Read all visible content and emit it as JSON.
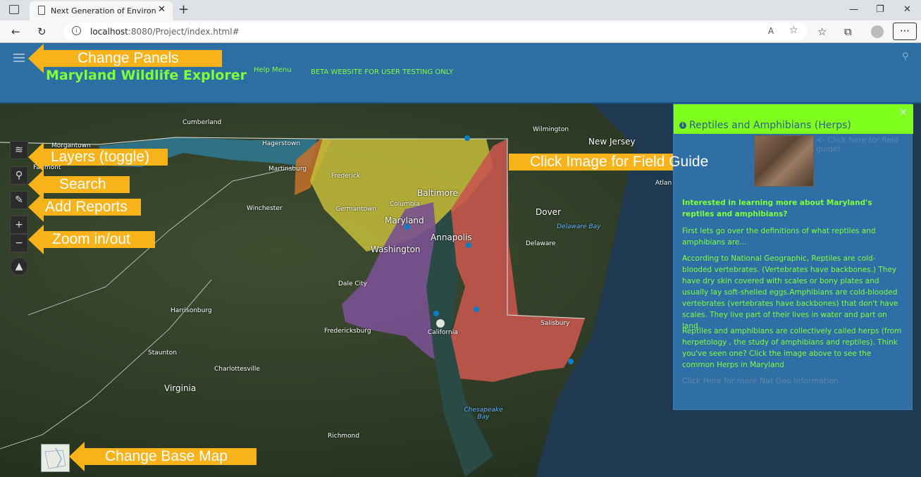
{
  "browser": {
    "tab_title": "Next Generation of Environment",
    "tab_close": "✕",
    "new_tab": "+",
    "url_host": "localhost",
    "url_path": ":8080/Project/index.html#",
    "win_min": "—",
    "win_max": "❐",
    "win_close": "✕",
    "more": "⋯"
  },
  "app": {
    "title": "Maryland Wildlife Explorer",
    "help_menu": "Help Menu",
    "beta": "BETA WEBSITE FOR USER TESTING ONLY"
  },
  "annotations": {
    "change_panels": "Change Panels",
    "layers": "Layers (toggle)",
    "search": "Search",
    "add_reports": "Add Reports",
    "zoom": "Zoom in/out",
    "field_guide": "Click Image for Field Guide",
    "base_map": "Change Base Map"
  },
  "map_labels": {
    "morgantown": "Morgantown",
    "fairmont": "Fairmont",
    "cumberland": "Cumberland",
    "hagerstown": "Hagerstown",
    "martinsburg": "Martinsburg",
    "frederick": "Frederick",
    "winchester": "Winchester",
    "germantown": "Germantown",
    "columbia": "Columbia",
    "baltimore": "Baltimore",
    "maryland": "Maryland",
    "annapolis": "Annapolis",
    "washington": "Washington",
    "dale_city": "Dale City",
    "harrisonburg": "Harrisonburg",
    "fredericksburg": "Fredericksburg",
    "california": "California",
    "staunton": "Staunton",
    "charlottesville": "Charlottesville",
    "virginia": "Virginia",
    "richmond": "Richmond",
    "chesapeake_bay": "Chesapeake Bay",
    "wilmington": "Wilmington",
    "new_jersey": "New Jersey",
    "dover": "Dover",
    "delaware_bay": "Delaware Bay",
    "delaware": "Delaware",
    "salisbury": "Salisbury",
    "atlantic": "Atlan"
  },
  "panel": {
    "title": "Reptiles and Amphibians (Herps)",
    "close": "✕",
    "field_hint": "<- Click here for field guide!",
    "intro": "Interested in learning more about Maryland's reptiles and amphibians?",
    "definitions": "First lets go over the definitions of what reptiles and amphibians are...",
    "description": "According to National Geographic, Reptiles are cold-blooded vertebrates. (Vertebrates have backbones.) They have dry skin covered with scales or bony plates and usually lay soft-shelled eggs.Amphibians are cold-blooded vertebrates (vertebrates have backbones) that don't have scales. They live part of their lives in water and part on land.",
    "herps": "Reptiles and amphibians are collectively called herps (from herpetology , the study of amphibians and reptiles). Think you've seen one? Click the image above to see the common Herps in Maryland",
    "natgeo_link": "Click Here for more Nat Geo Information"
  }
}
